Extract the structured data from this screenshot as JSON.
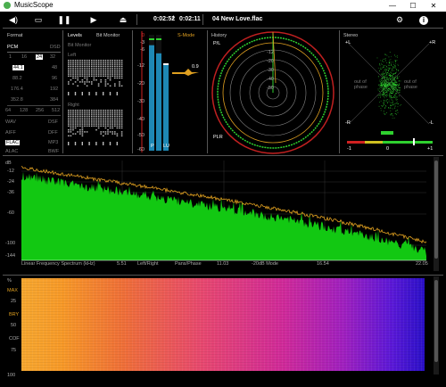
{
  "window": {
    "title": "MusicScope",
    "min": "—",
    "max": "☐",
    "close": "✕"
  },
  "toolbar": {
    "time_pos": "0:02:52",
    "time_sep": "/",
    "time_total": "0:02:11",
    "track": "04 New Love.flac"
  },
  "format": {
    "title": "Format",
    "pcm": "PCM",
    "dsd": "DSD",
    "bits": [
      "1",
      "16",
      "24",
      "32"
    ],
    "rates_left": [
      "44.1",
      "88.2",
      "176.4",
      "352.8"
    ],
    "rates_right": [
      "48",
      "96",
      "192",
      "384"
    ],
    "dsd_rates": [
      "64",
      "128",
      "256",
      "512"
    ],
    "types": [
      [
        "WAV",
        "DSF"
      ],
      [
        "AIFF",
        "DFF"
      ],
      [
        "FLAC",
        "MP3"
      ],
      [
        "ALAC",
        "BWF"
      ]
    ]
  },
  "levels": {
    "title": "Levels",
    "bit_monitor": "Bit Monitor",
    "bit_monitor2": "Bit Monitor",
    "left": "Left",
    "right": "Right"
  },
  "meter": {
    "scale": [
      "0",
      "-3",
      "-6",
      "-12",
      "-20",
      "-30",
      "-40",
      "-50",
      "-60"
    ],
    "peak_readout": "0.9",
    "labels": [
      "P",
      "LU"
    ],
    "mode": "S-Mode",
    "left_fill": 0.91,
    "right_fill": 0.84
  },
  "history": {
    "title": "History",
    "pl": "P/L",
    "plr": "PLR",
    "rings": [
      "-12",
      "-20",
      "-30",
      "-40",
      "-50"
    ]
  },
  "stereo": {
    "title": "Stereo",
    "pl": "+L",
    "pr": "+R",
    "ml": "-R",
    "mr": "-L",
    "out_left": "out of phase",
    "out_right": "out of phase",
    "corr_left": "-1",
    "corr_mid": "0",
    "corr_right": "+1"
  },
  "spectrum": {
    "unit": "dB",
    "yticks": [
      "-12",
      "-24",
      "-36",
      "-60",
      "-100",
      "-144"
    ],
    "caption": "Linear Frequency Spectrum (kHz)",
    "xticks": [
      "5.51",
      "11.03",
      "16.54",
      "22.05"
    ],
    "modes": [
      "Left/Right",
      "Pans/Phase",
      "-20dB Mode"
    ]
  },
  "spectrogram": {
    "unit": "%",
    "yticks": [
      "MAX",
      "25",
      "BRY",
      "50",
      "COF",
      "75",
      "100"
    ]
  },
  "colors": {
    "accent": "#2fd12f",
    "spectrum_fill": "#12c812",
    "peak_line": "#e0a020",
    "meter_red": "#d02020",
    "meter_blue": "#1e88b4"
  }
}
